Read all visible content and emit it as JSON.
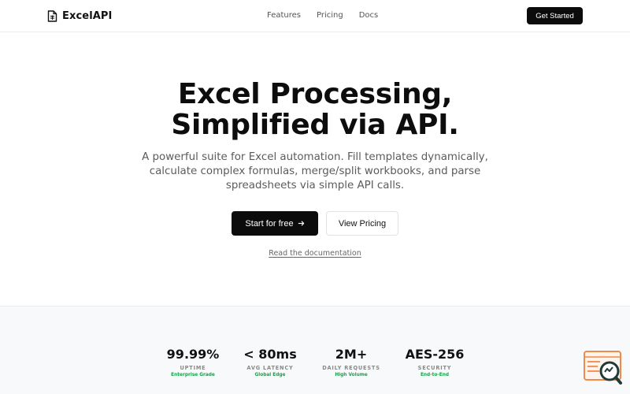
{
  "header": {
    "brand": "ExcelAPI",
    "nav": [
      {
        "label": "Features"
      },
      {
        "label": "Pricing"
      },
      {
        "label": "Docs"
      }
    ],
    "cta": "Get Started"
  },
  "hero": {
    "title_line1": "Excel Processing,",
    "title_line2": "Simplified via API.",
    "subtitle": "A powerful suite for Excel automation. Fill templates dynamically, calculate complex formulas, merge/split workbooks, and parse spreadsheets via simple API calls.",
    "primary_cta": "Start for free",
    "secondary_cta": "View Pricing",
    "doc_link": "Read the documentation"
  },
  "stats": [
    {
      "value": "99.99%",
      "label": "UPTIME",
      "sub": "Enterprise Grade"
    },
    {
      "value": "< 80ms",
      "label": "AVG LATENCY",
      "sub": "Global Edge"
    },
    {
      "value": "2M+",
      "label": "DAILY REQUESTS",
      "sub": "High Volume"
    },
    {
      "value": "AES-256",
      "label": "SECURITY",
      "sub": "End-to-End"
    }
  ],
  "colors": {
    "primary": "#0b0b0b",
    "accent_green": "#16a34a",
    "widget_orange": "#f08a4b"
  },
  "icons": {
    "brand": "spreadsheet-file-icon",
    "cta_arrow": "arrow-right-icon",
    "widget": "search-analytics-icon"
  }
}
